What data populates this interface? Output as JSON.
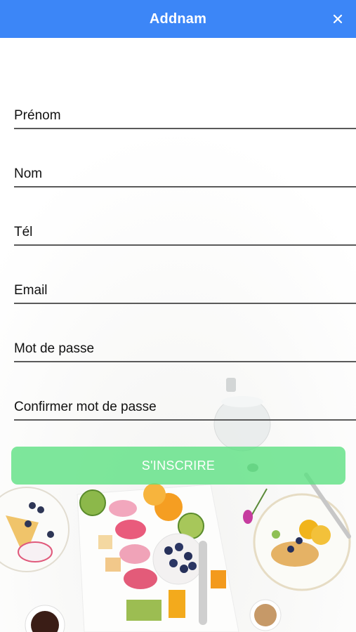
{
  "header": {
    "title": "Addnam",
    "close_icon": "close-icon",
    "background_color": "#3c86f7"
  },
  "form": {
    "fields": [
      {
        "placeholder": "Prénom",
        "value": ""
      },
      {
        "placeholder": "Nom",
        "value": ""
      },
      {
        "placeholder": "Tél",
        "value": ""
      },
      {
        "placeholder": "Email",
        "value": ""
      },
      {
        "placeholder": "Mot de passe",
        "value": ""
      },
      {
        "placeholder": "Confirmer mot de passe",
        "value": ""
      }
    ],
    "submit_label": "S'INSCRIRE",
    "submit_color": "#5ae080"
  },
  "background": {
    "subject": "breakfast-food-photo"
  }
}
